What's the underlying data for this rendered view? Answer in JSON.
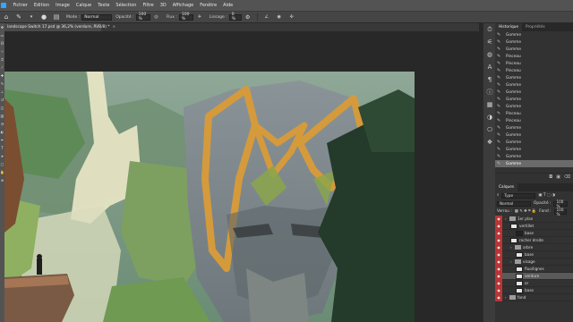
{
  "app": {
    "menu": [
      "Fichier",
      "Edition",
      "Image",
      "Calque",
      "Texte",
      "Sélection",
      "Filtre",
      "3D",
      "Affichage",
      "Fenêtre",
      "Aide"
    ]
  },
  "options": {
    "mode_label": "Mode :",
    "mode_value": "Normal",
    "opacity_label": "Opacité :",
    "opacity_value": "100 %",
    "flow_label": "Flux :",
    "flow_value": "100 %",
    "smoothing_label": "Lissage :",
    "smoothing_value": "0 %"
  },
  "document": {
    "tab_title": "landscape Switch 17.psd @ 36,2% (verdure, RVB/8) *",
    "close_glyph": "×"
  },
  "panels": {
    "history_tab": "Historique",
    "properties_tab": "Propriétés",
    "layers_tab": "Calques",
    "history": [
      "Gomme",
      "Gomme",
      "Gomme",
      "Pinceau",
      "Pinceau",
      "Pinceau",
      "Gomme",
      "Gomme",
      "Gomme",
      "Gomme",
      "Gomme",
      "Pinceau",
      "Pinceau",
      "Gomme",
      "Gomme",
      "Gomme",
      "Gomme",
      "Gomme",
      "Gomme"
    ],
    "history_selected_index": 18,
    "layers_filter": "Type",
    "layers_blend": "Normal",
    "layers_opacity_label": "Opacité :",
    "layers_opacity": "100 %",
    "layers_fill_label": "Fond :",
    "layers_fill": "100 %",
    "layers_lock_label": "Verrou :",
    "layers": [
      {
        "name": "1er plan",
        "kind": "folder",
        "depth": 0
      },
      {
        "name": "vertillet",
        "kind": "layer",
        "depth": 1,
        "thumb": "light"
      },
      {
        "name": "base",
        "kind": "layer",
        "depth": 2,
        "thumb": "dark"
      },
      {
        "name": "rocher droite",
        "kind": "layer",
        "depth": 1,
        "thumb": "light"
      },
      {
        "name": "arbre",
        "kind": "folder",
        "depth": 1
      },
      {
        "name": "base",
        "kind": "layer",
        "depth": 2,
        "thumb": "light"
      },
      {
        "name": "visage",
        "kind": "folder",
        "depth": 1
      },
      {
        "name": "fluo/lignes",
        "kind": "layer",
        "depth": 2,
        "thumb": "light"
      },
      {
        "name": "verdure",
        "kind": "layer",
        "depth": 2,
        "thumb": "light",
        "selected": true
      },
      {
        "name": "or",
        "kind": "layer",
        "depth": 2,
        "thumb": "light"
      },
      {
        "name": "base",
        "kind": "layer",
        "depth": 2,
        "thumb": "light"
      },
      {
        "name": "fond",
        "kind": "folder",
        "depth": 0
      }
    ]
  }
}
